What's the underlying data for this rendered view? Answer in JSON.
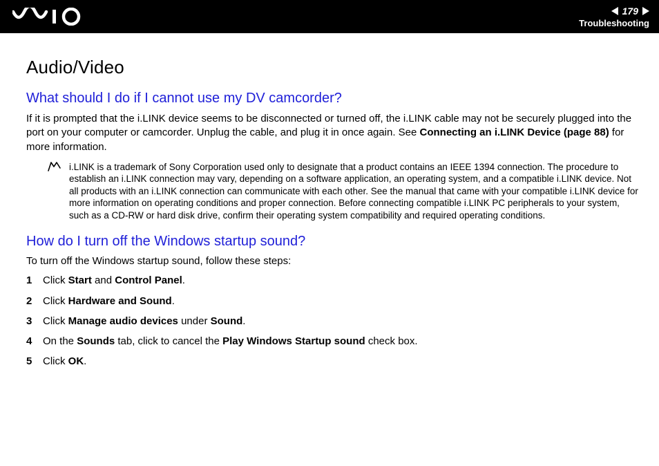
{
  "header": {
    "page_number": "179",
    "section": "Troubleshooting"
  },
  "main": {
    "title": "Audio/Video",
    "q1": {
      "heading": "What should I do if I cannot use my DV camcorder?",
      "para_pre": "If it is prompted that the i.LINK device seems to be disconnected or turned off, the i.LINK cable may not be securely plugged into the port on your computer or camcorder. Unplug the cable, and plug it in once again. See ",
      "para_link": "Connecting an i.LINK Device (page 88)",
      "para_post": " for more information.",
      "note": "i.LINK is a trademark of Sony Corporation used only to designate that a product contains an IEEE 1394 connection. The procedure to establish an i.LINK connection may vary, depending on a software application, an operating system, and a compatible i.LINK device. Not all products with an i.LINK connection can communicate with each other. See the manual that came with your compatible i.LINK device for more information on operating conditions and proper connection. Before connecting compatible i.LINK PC peripherals to your system, such as a CD-RW or hard disk drive, confirm their operating system compatibility and required operating conditions."
    },
    "q2": {
      "heading": "How do I turn off the Windows startup sound?",
      "intro": "To turn off the Windows startup sound, follow these steps:",
      "steps": {
        "s1_pre": "Click ",
        "s1_b1": "Start",
        "s1_mid": " and ",
        "s1_b2": "Control Panel",
        "s1_post": ".",
        "s2_pre": "Click ",
        "s2_b1": "Hardware and Sound",
        "s2_post": ".",
        "s3_pre": "Click ",
        "s3_b1": "Manage audio devices",
        "s3_mid": " under ",
        "s3_b2": "Sound",
        "s3_post": ".",
        "s4_pre": "On the ",
        "s4_b1": "Sounds",
        "s4_mid": " tab, click to cancel the ",
        "s4_b2": "Play Windows Startup sound",
        "s4_post": " check box.",
        "s5_pre": "Click ",
        "s5_b1": "OK",
        "s5_post": "."
      }
    }
  }
}
